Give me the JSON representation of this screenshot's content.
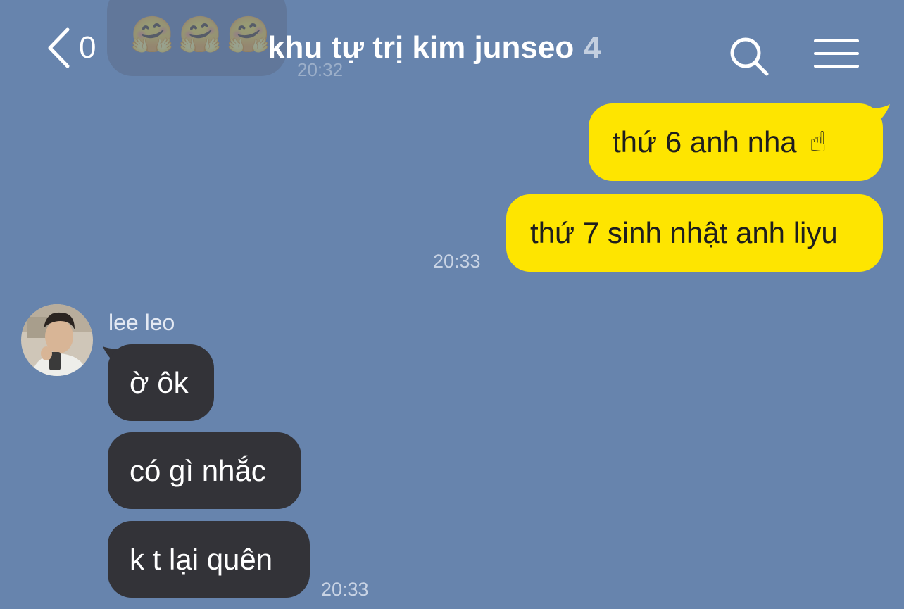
{
  "header": {
    "unread_count": "0",
    "title": "khu tự trị kim junseo",
    "member_count": "4"
  },
  "background_message": {
    "emojis": "🤗🤗🤗",
    "time": "20:32"
  },
  "messages_outgoing": [
    {
      "text": "thứ 6 anh nha",
      "emoji": "☝"
    },
    {
      "text": "thứ 7 sinh nhật anh liyu"
    }
  ],
  "outgoing_time": "20:33",
  "incoming": {
    "sender": "lee leo",
    "messages": [
      {
        "text": "ờ ôk"
      },
      {
        "text": "có gì nhắc"
      },
      {
        "text": "k t lại quên"
      }
    ],
    "time": "20:33"
  },
  "colors": {
    "background": "#6784ad",
    "outgoing_bubble": "#fee500",
    "incoming_bubble": "#333338"
  },
  "icons": {
    "back": "chevron-left-icon",
    "search": "search-icon",
    "menu": "hamburger-menu-icon"
  }
}
